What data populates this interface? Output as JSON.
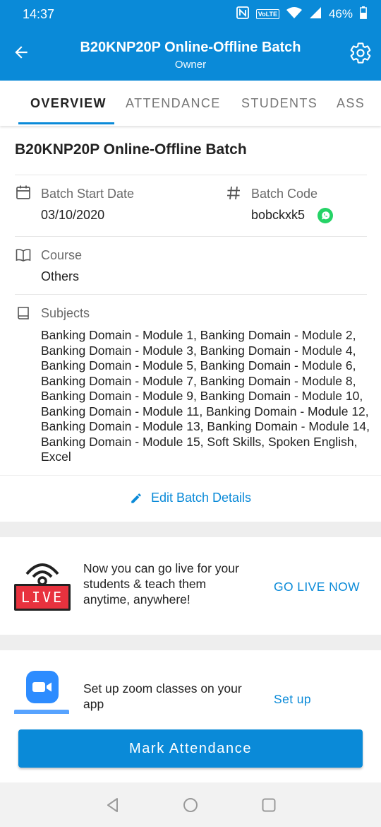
{
  "status_bar": {
    "time": "14:37",
    "nfc_icon": "nfc-icon",
    "volte": "VoLTE",
    "battery": "46%"
  },
  "app_bar": {
    "title": "B20KNP20P  Online-Offline Batch",
    "subtitle": "Owner",
    "back_icon": "arrow-back-icon",
    "settings_icon": "gear-icon"
  },
  "tabs": [
    {
      "label": "OVERVIEW",
      "active": true
    },
    {
      "label": "ATTENDANCE",
      "active": false
    },
    {
      "label": "STUDENTS",
      "active": false
    },
    {
      "label": "ASS",
      "active": false
    }
  ],
  "overview": {
    "batch_name": "B20KNP20P  Online-Offline Batch",
    "start_date_label": "Batch Start Date",
    "start_date_value": "03/10/2020",
    "batch_code_label": "Batch Code",
    "batch_code_value": "bobckxk5",
    "course_label": "Course",
    "course_value": "Others",
    "subjects_label": "Subjects",
    "subjects_value": "Banking Domain - Module 1, Banking Domain - Module 2, Banking Domain - Module 3, Banking Domain - Module 4, Banking Domain - Module 5, Banking Domain - Module 6, Banking Domain - Module 7, Banking Domain - Module 8, Banking Domain - Module 9, Banking Domain - Module 10, Banking Domain - Module 11, Banking Domain - Module 12, Banking Domain - Module 13, Banking Domain - Module 14, Banking Domain - Module 15, Soft Skills, Spoken English, Excel",
    "edit_label": "Edit Batch Details"
  },
  "live_card": {
    "badge_text": "LIVE",
    "text_line1": "Now you can go live for your",
    "text_line2": "students & teach them",
    "text_line3": "anytime, anywhere!",
    "action": "GO LIVE NOW"
  },
  "zoom_card": {
    "text_line1": "Set up zoom classes on your",
    "text_line2": "app",
    "action": "Set up"
  },
  "bottom": {
    "mark_attendance": "Mark Attendance"
  },
  "colors": {
    "primary": "#0a8ad8",
    "live_red": "#e8323e",
    "whatsapp_green": "#25d366",
    "zoom_blue": "#2d8cff"
  }
}
